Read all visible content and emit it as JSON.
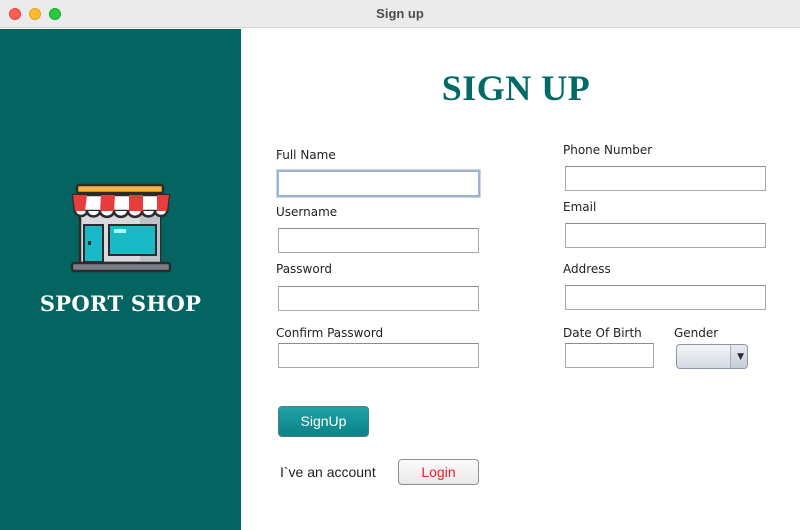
{
  "window": {
    "title": "Sign up"
  },
  "sidebar": {
    "brand": "SPORT SHOP",
    "icon": "storefront-icon",
    "background": "#036461"
  },
  "form": {
    "title": "SIGN UP",
    "full_name": {
      "label": "Full Name",
      "value": ""
    },
    "username": {
      "label": "Username",
      "value": ""
    },
    "password": {
      "label": "Password",
      "value": ""
    },
    "confirm_password": {
      "label": "Confirm Password",
      "value": ""
    },
    "phone_number": {
      "label": "Phone Number",
      "value": ""
    },
    "email": {
      "label": "Email",
      "value": ""
    },
    "address": {
      "label": "Address",
      "value": ""
    },
    "date_of_birth": {
      "label": "Date Of Birth",
      "value": ""
    },
    "gender": {
      "label": "Gender",
      "selected": ""
    },
    "signup_label": "SignUp",
    "account_text": "I`ve an account",
    "login_label": "Login"
  },
  "colors": {
    "accent": "#016a67",
    "signup_button": "#1a9a9e",
    "login_text": "#ee2020"
  }
}
